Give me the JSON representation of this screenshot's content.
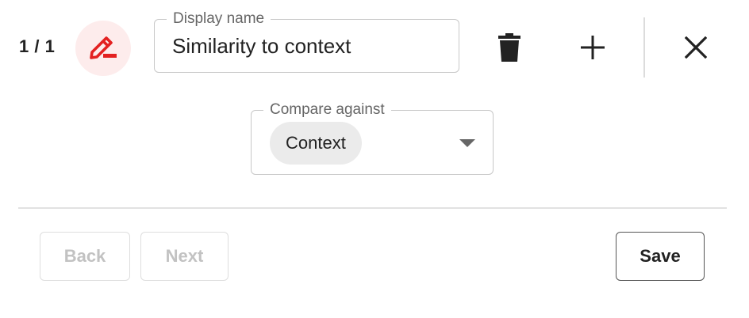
{
  "header": {
    "counter": "1 / 1",
    "avatar_icon": "edit-pen-icon",
    "avatar_color": "#e32121",
    "avatar_bg": "#fdecec"
  },
  "display_name": {
    "label": "Display name",
    "value": "Similarity to context"
  },
  "actions": {
    "delete_icon": "trash-icon",
    "add_icon": "plus-icon",
    "close_icon": "close-icon"
  },
  "compare": {
    "label": "Compare against",
    "selected": "Context"
  },
  "footer": {
    "back_label": "Back",
    "next_label": "Next",
    "save_label": "Save"
  }
}
